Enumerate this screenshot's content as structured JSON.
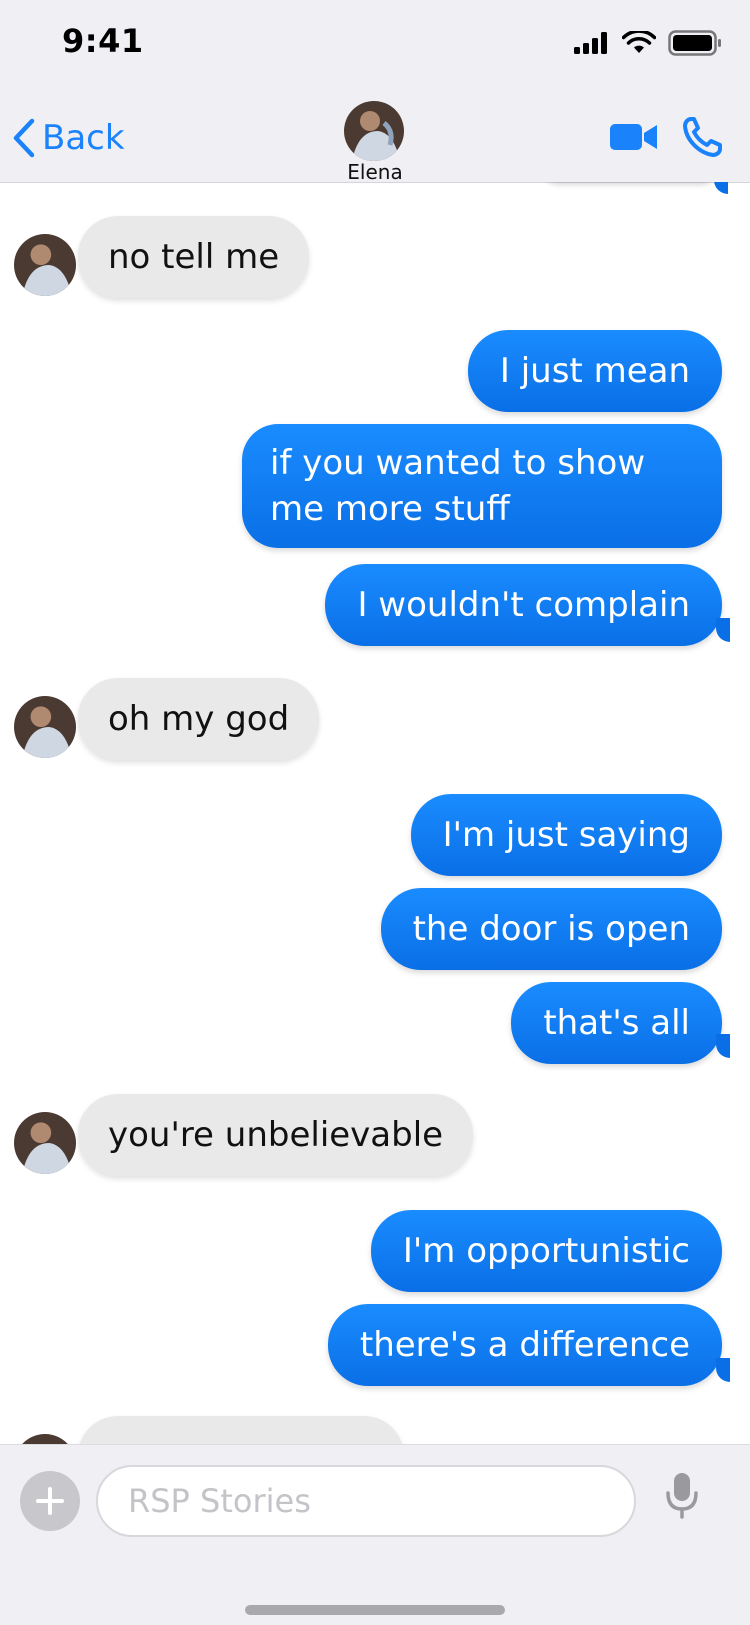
{
  "status": {
    "time": "9:41"
  },
  "header": {
    "back_label": "Back",
    "contact_name": "Elena"
  },
  "messages": {
    "m1": "no tell me",
    "m2": "I just mean",
    "m3": "if you wanted to show me more stuff",
    "m4": "I wouldn't complain",
    "m5": "oh my god",
    "m6": "I'm just saying",
    "m7": "the door is open",
    "m8": "that's all",
    "m9": "you're unbelievable",
    "m10": "I'm opportunistic",
    "m11": "there's a difference"
  },
  "input": {
    "placeholder": "RSP Stories"
  },
  "colors": {
    "accent": "#1a82fb",
    "sent_bubble": "#0a7cf5",
    "received_bubble": "#e9e9ea",
    "bar_background": "#efeff4"
  },
  "icons": {
    "back": "chevron-left-icon",
    "video": "video-camera-icon",
    "phone": "phone-icon",
    "add": "plus-icon",
    "mic": "microphone-icon",
    "signal": "cellular-signal-icon",
    "wifi": "wifi-icon",
    "battery": "battery-icon"
  }
}
